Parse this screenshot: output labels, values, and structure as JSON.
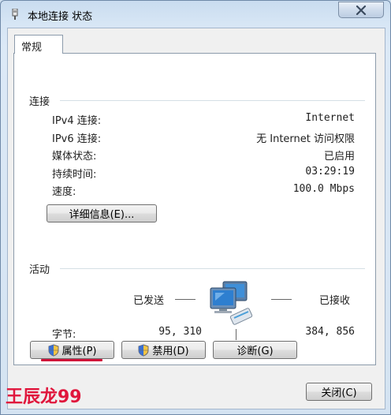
{
  "window": {
    "title": "本地连接 状态"
  },
  "tabs": [
    {
      "label": "常规"
    }
  ],
  "connection": {
    "group_title": "连接",
    "rows": [
      {
        "label": "IPv4 连接:",
        "value": "Internet"
      },
      {
        "label": "IPv6 连接:",
        "value": "无 Internet 访问权限"
      },
      {
        "label": "媒体状态:",
        "value": "已启用"
      },
      {
        "label": "持续时间:",
        "value": "03:29:19"
      },
      {
        "label": "速度:",
        "value": "100.0 Mbps"
      }
    ],
    "details_button": "详细信息(E)..."
  },
  "activity": {
    "group_title": "活动",
    "sent_label": "已发送",
    "received_label": "已接收",
    "bytes_label": "字节:",
    "bytes_sent": "95, 310",
    "bytes_received": "384, 856"
  },
  "buttons": {
    "properties": "属性(P)",
    "disable": "禁用(D)",
    "diagnose": "诊断(G)",
    "close": "关闭(C)"
  },
  "watermark": {
    "text": "王辰龙99",
    "color": "#e0163c"
  },
  "colors": {
    "highlight_underline": "#d0103a",
    "title_bar": "#c9dcef"
  }
}
